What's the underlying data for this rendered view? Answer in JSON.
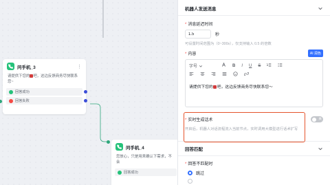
{
  "canvas": {
    "node1": {
      "title": "问手机_3",
      "body_before": "请提供下您的",
      "body_after": "吧，这边反馈商务尽快联系您~",
      "branch_ok": "回答成功",
      "branch_fail": "回答失败"
    },
    "node2": {
      "title": "问手机_4",
      "body": "您放心，只是用来确认下需求，不会",
      "branch_ok": "回答成功"
    }
  },
  "panel": {
    "section_robot": "机器人发送消息",
    "delay_label": "消息延迟时间",
    "delay_value": "1.5",
    "delay_unit": "秒",
    "delay_hint": "可设置时间范围为（0~300s），仅支持输入 0.5 的倍数",
    "content_label": "内容",
    "ai_button": "AI 润色",
    "font_select": "字号",
    "toolbar_b": "B",
    "toolbar_i": "I",
    "toolbar_u": "U",
    "toolbar_s": "S",
    "editor_before": "请提供下您的",
    "editor_after": "吧，这边反馈商务尽快联系您～",
    "realtime_label": "实时生成话术",
    "toggle_label": "关",
    "realtime_hint": "开启后，机器人对话流程流入当前节点，实时调用大模型进行话术扩写",
    "section_reply": "回答匹配",
    "mismatch_label": "回答不匹配时",
    "option_skip": "跳过"
  }
}
